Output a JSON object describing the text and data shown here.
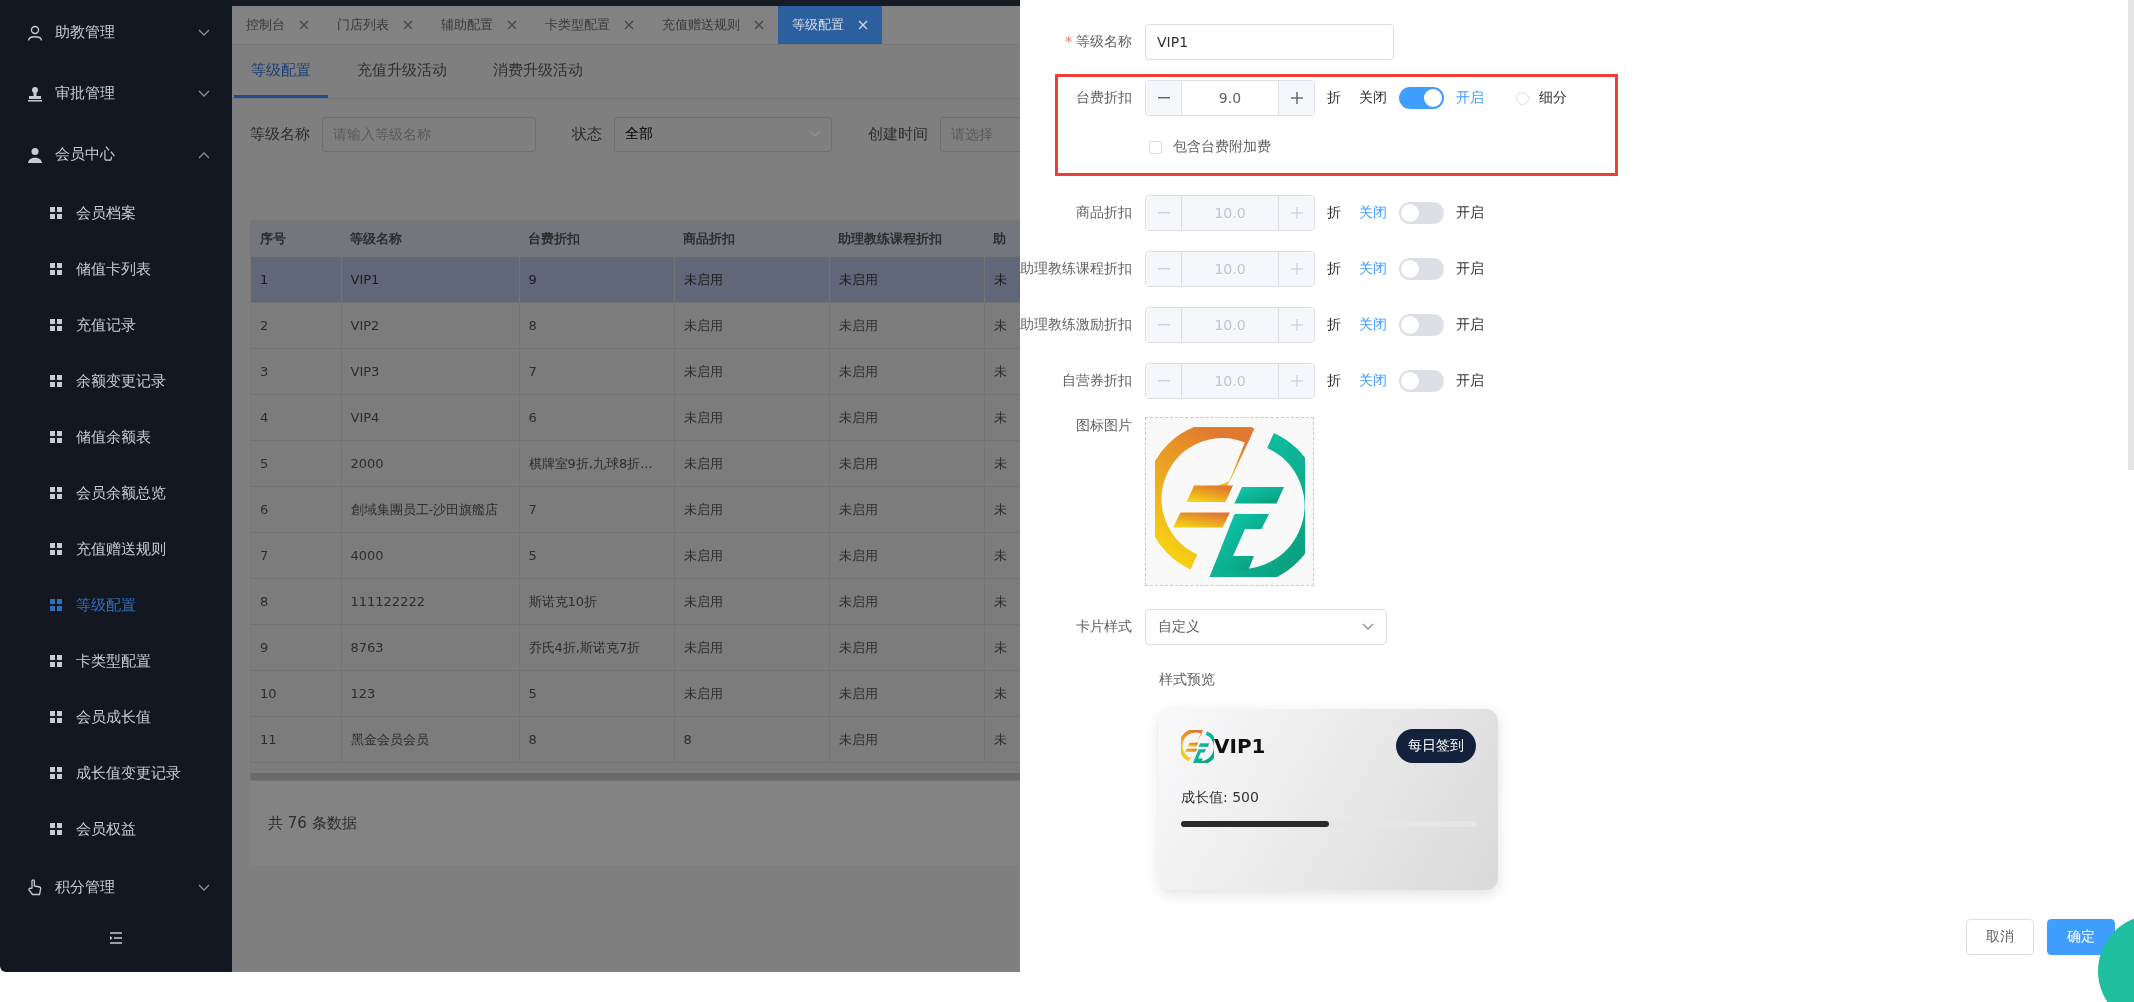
{
  "sidebar": {
    "items": [
      {
        "label": "助教管理",
        "expanded": false
      },
      {
        "label": "审批管理",
        "expanded": false
      },
      {
        "label": "会员中心",
        "expanded": true,
        "children": [
          {
            "label": "会员档案",
            "selected": false
          },
          {
            "label": "储值卡列表",
            "selected": false
          },
          {
            "label": "充值记录",
            "selected": false
          },
          {
            "label": "余额变更记录",
            "selected": false
          },
          {
            "label": "储值余额表",
            "selected": false
          },
          {
            "label": "会员余额总览",
            "selected": false
          },
          {
            "label": "充值赠送规则",
            "selected": false
          },
          {
            "label": "等级配置",
            "selected": true
          },
          {
            "label": "卡类型配置",
            "selected": false
          },
          {
            "label": "会员成长值",
            "selected": false
          },
          {
            "label": "成长值变更记录",
            "selected": false
          },
          {
            "label": "会员权益",
            "selected": false
          }
        ]
      },
      {
        "label": "积分管理",
        "expanded": false
      }
    ]
  },
  "tabs": [
    {
      "label": "控制台",
      "selected": false
    },
    {
      "label": "门店列表",
      "selected": false
    },
    {
      "label": "辅助配置",
      "selected": false
    },
    {
      "label": "卡类型配置",
      "selected": false
    },
    {
      "label": "充值赠送规则",
      "selected": false
    },
    {
      "label": "等级配置",
      "selected": true
    }
  ],
  "subtabs": [
    {
      "label": "等级配置",
      "selected": true
    },
    {
      "label": "充值升级活动",
      "selected": false
    },
    {
      "label": "消费升级活动",
      "selected": false
    }
  ],
  "filters": [
    {
      "kind": "text",
      "label": "等级名称",
      "placeholder": "请输入等级名称"
    },
    {
      "kind": "select",
      "label": "状态",
      "value": "全部"
    },
    {
      "kind": "date",
      "label": "创建时间",
      "placeholder": "请选择"
    }
  ],
  "table": {
    "columns": [
      "序号",
      "等级名称",
      "台费折扣",
      "商品折扣",
      "助理教练课程折扣",
      "助"
    ],
    "rows": [
      {
        "selected": true,
        "cells": [
          "1",
          "VIP1",
          "9",
          "未启用",
          "未启用",
          "未"
        ]
      },
      {
        "selected": false,
        "cells": [
          "2",
          "VIP2",
          "8",
          "未启用",
          "未启用",
          "未"
        ]
      },
      {
        "selected": false,
        "cells": [
          "3",
          "VIP3",
          "7",
          "未启用",
          "未启用",
          "未"
        ]
      },
      {
        "selected": false,
        "cells": [
          "4",
          "VIP4",
          "6",
          "未启用",
          "未启用",
          "未"
        ]
      },
      {
        "selected": false,
        "cells": [
          "5",
          "2000",
          "棋牌室9折,九球8折...",
          "未启用",
          "未启用",
          "未"
        ]
      },
      {
        "selected": false,
        "cells": [
          "6",
          "創域集團员工-沙田旗艦店",
          "7",
          "未启用",
          "未启用",
          "未"
        ]
      },
      {
        "selected": false,
        "cells": [
          "7",
          "4000",
          "5",
          "未启用",
          "未启用",
          "未"
        ]
      },
      {
        "selected": false,
        "cells": [
          "8",
          "111122222",
          "斯诺克10折",
          "未启用",
          "未启用",
          "未"
        ]
      },
      {
        "selected": false,
        "cells": [
          "9",
          "8763",
          "乔氏4折,斯诺克7折",
          "未启用",
          "未启用",
          "未"
        ]
      },
      {
        "selected": false,
        "cells": [
          "10",
          "123",
          "5",
          "未启用",
          "未启用",
          "未"
        ]
      },
      {
        "selected": false,
        "cells": [
          "11",
          "黑金会员会员",
          "8",
          "8",
          "未启用",
          "未"
        ]
      }
    ],
    "total": "共 76 条数据"
  },
  "form": {
    "name_field": {
      "label": "等级名称",
      "required_mark": "*",
      "value": "VIP1"
    },
    "discounts": [
      {
        "label": "台费折扣",
        "value": "9.0",
        "unit": "折",
        "off_label": "关闭",
        "on_label": "开启",
        "enabled": true,
        "highlighted": true,
        "detail_option": {
          "label": "细分",
          "selected": false
        },
        "surcharge_option": {
          "label": "包含台费附加费",
          "checked": false
        }
      },
      {
        "label": "商品折扣",
        "value": "10.0",
        "unit": "折",
        "off_label": "关闭",
        "on_label": "开启",
        "enabled": false,
        "highlighted": false
      },
      {
        "label": "助理教练课程折扣",
        "value": "10.0",
        "unit": "折",
        "off_label": "关闭",
        "on_label": "开启",
        "enabled": false,
        "highlighted": false
      },
      {
        "label": "助理教练激励折扣",
        "value": "10.0",
        "unit": "折",
        "off_label": "关闭",
        "on_label": "开启",
        "enabled": false,
        "highlighted": false
      },
      {
        "label": "自营券折扣",
        "value": "10.0",
        "unit": "折",
        "off_label": "关闭",
        "on_label": "开启",
        "enabled": false,
        "highlighted": false
      }
    ],
    "icon_image": {
      "label": "图标图片"
    },
    "card_style": {
      "label": "卡片样式",
      "value": "自定义"
    },
    "preview": {
      "label": "样式预览",
      "card": {
        "title": "VIP1",
        "badge": "每日签到",
        "growth": "成长值: 500",
        "level": 0.5
      }
    }
  },
  "buttons": [
    {
      "label": "取消",
      "kind": "secondary"
    },
    {
      "label": "确定",
      "kind": "primary"
    }
  ]
}
